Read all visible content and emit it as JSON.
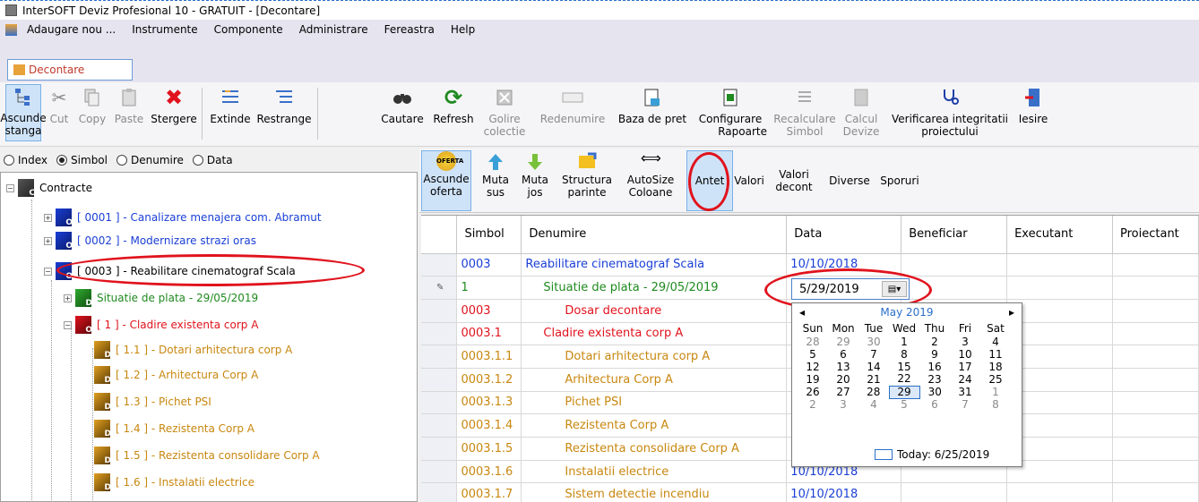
{
  "window": {
    "title": "InterSOFT Deviz Profesional 10 - GRATUIT - [Decontare]"
  },
  "menu": [
    "Adaugare nou ...",
    "Instrumente",
    "Componente",
    "Administrare",
    "Fereastra",
    "Help"
  ],
  "doc_tab": "Decontare",
  "toolbar": {
    "ascunde": [
      "Ascunde",
      "stanga"
    ],
    "cut": "Cut",
    "copy": "Copy",
    "paste": "Paste",
    "stergere": "Stergere",
    "extinde": "Extinde",
    "restrange": "Restrange",
    "cautare": "Cautare",
    "refresh": "Refresh",
    "golire": [
      "Golire",
      "colectie"
    ],
    "redenumire": "Redenumire",
    "baza": "Baza de pret",
    "configurare": [
      "Configurare",
      "Rapoarte"
    ],
    "recalculare": [
      "Recalculare",
      "Simbol"
    ],
    "calcul": [
      "Calcul",
      "Devize"
    ],
    "verificarea": [
      "Verificarea integritatii",
      "proiectului"
    ],
    "iesire": "Iesire"
  },
  "view_options": {
    "labels": [
      "Index",
      "Simbol",
      "Denumire",
      "Data"
    ],
    "selected": "Simbol"
  },
  "tree": {
    "root": "Contracte",
    "items": [
      "[ 0001 ] - Canalizare menajera com. Abramut",
      "[ 0002 ] - Modernizare strazi oras",
      "[ 0003 ] - Reabilitare cinematograf Scala",
      "Situatie de plata - 29/05/2019",
      "[ 1 ] - Cladire existenta corp A",
      "[ 1.1 ] - Dotari arhitectura corp A",
      "[ 1.2 ] - Arhitectura Corp A",
      "[ 1.3 ] - Pichet PSI",
      "[ 1.4 ] - Rezistenta Corp A",
      "[ 1.5 ] - Rezistenta consolidare Corp A",
      "[ 1.6 ] - Instalatii electrice"
    ],
    "icon_glyphs": [
      "C",
      "O",
      "D"
    ]
  },
  "ribbon": {
    "ascunde": [
      "Ascunde",
      "oferta"
    ],
    "oferta_icon_text": "OFERTA",
    "muta_sus": [
      "Muta",
      "sus"
    ],
    "muta_jos": [
      "Muta",
      "jos"
    ],
    "structura": [
      "Structura",
      "parinte"
    ],
    "autosize": [
      "AutoSize",
      "Coloane"
    ],
    "antet": "Antet",
    "valori": "Valori",
    "valori_decont": [
      "Valori",
      "decont"
    ],
    "diverse": "Diverse",
    "sporuri": "Sporuri"
  },
  "grid": {
    "columns": [
      "Simbol",
      "Denumire",
      "Data",
      "Beneficiar",
      "Executant",
      "Proiectant"
    ],
    "rows": [
      {
        "simbol": "0003",
        "denumire": "Reabilitare cinematograf Scala",
        "data": "10/10/2018"
      },
      {
        "simbol": "1",
        "denumire": "Situatie de plata - 29/05/2019",
        "data": ""
      },
      {
        "simbol": "0003",
        "denumire": "Dosar decontare",
        "data": ""
      },
      {
        "simbol": "0003.1",
        "denumire": "Cladire existenta corp A",
        "data": ""
      },
      {
        "simbol": "0003.1.1",
        "denumire": "Dotari arhitectura corp A",
        "data": ""
      },
      {
        "simbol": "0003.1.2",
        "denumire": "Arhitectura Corp A",
        "data": ""
      },
      {
        "simbol": "0003.1.3",
        "denumire": "Pichet PSI",
        "data": ""
      },
      {
        "simbol": "0003.1.4",
        "denumire": "Rezistenta Corp A",
        "data": ""
      },
      {
        "simbol": "0003.1.5",
        "denumire": "Rezistenta consolidare Corp A",
        "data": ""
      },
      {
        "simbol": "0003.1.6",
        "denumire": "Instalatii electrice",
        "data": "10/10/2018"
      },
      {
        "simbol": "0003.1.7",
        "denumire": "Sistem detectie incendiu",
        "data": "10/10/2018"
      }
    ]
  },
  "date_editor": {
    "value": "5/29/2019"
  },
  "calendar": {
    "month": "May 2019",
    "weekdays": [
      "Sun",
      "Mon",
      "Tue",
      "Wed",
      "Thu",
      "Fri",
      "Sat"
    ],
    "weeks": [
      [
        "28",
        "29",
        "30",
        "1",
        "2",
        "3",
        "4"
      ],
      [
        "5",
        "6",
        "7",
        "8",
        "9",
        "10",
        "11"
      ],
      [
        "12",
        "13",
        "14",
        "15",
        "16",
        "17",
        "18"
      ],
      [
        "19",
        "20",
        "21",
        "22",
        "23",
        "24",
        "25"
      ],
      [
        "26",
        "27",
        "28",
        "29",
        "30",
        "31",
        "1"
      ],
      [
        "2",
        "3",
        "4",
        "5",
        "6",
        "7",
        "8"
      ]
    ],
    "today": "Today: 6/25/2019"
  },
  "colors": {
    "blue": "#1a3fd6",
    "green": "#1f8a1f",
    "red": "#e0131d",
    "orange": "#c8870f",
    "highlight": "#e0131d"
  }
}
